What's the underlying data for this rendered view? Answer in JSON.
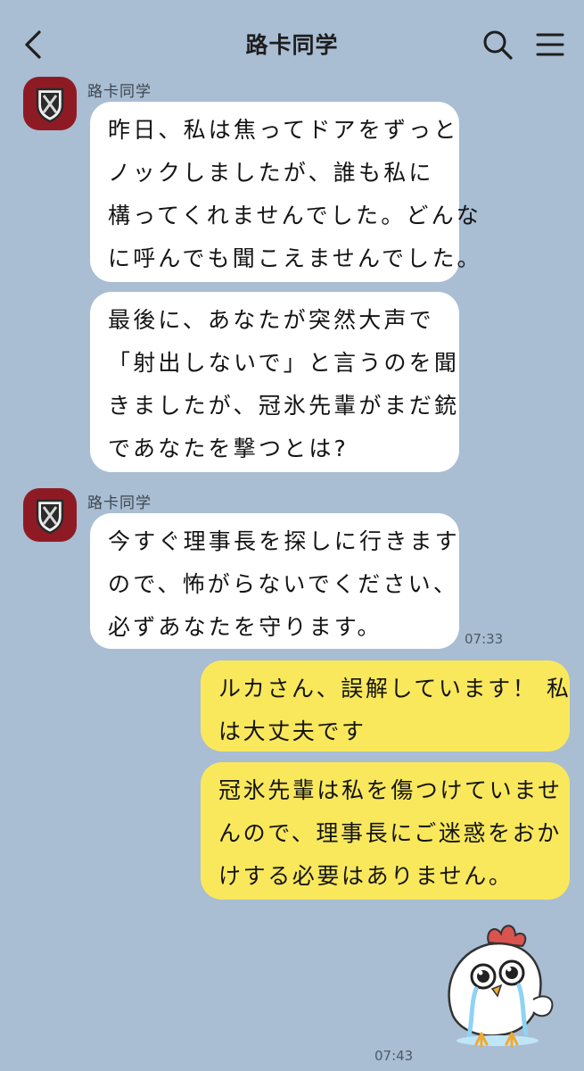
{
  "header": {
    "title": "路卡同学",
    "back_icon": "chevron-left-icon",
    "search_icon": "search-icon",
    "menu_icon": "hamburger-menu-icon"
  },
  "messages": [
    {
      "sender": "路卡同学",
      "lines": [
        "昨日、私は焦ってドアをずっと",
        "ノックしましたが、誰も私に",
        "構ってくれませんでした。どんな",
        "に呼んでも聞こえませんでした。"
      ]
    },
    {
      "lines": [
        "最後に、あなたが突然大声で",
        "「射出しないで」と言うのを聞",
        "きましたが、冠氷先輩がまだ銃",
        "であなたを撃つとは?"
      ]
    },
    {
      "sender": "路卡同学",
      "lines": [
        "今すぐ理事長を探しに行きます",
        "ので、怖がらないでください、",
        "必ずあなたを守ります。"
      ],
      "time": "07:33"
    },
    {
      "mine": true,
      "lines": [
        "ルカさん、誤解しています！ 私",
        "は大丈夫です"
      ]
    },
    {
      "mine": true,
      "lines": [
        "冠氷先輩は私を傷つけていませ",
        "んので、理事長にご迷惑をおか",
        "けする必要はありません。"
      ]
    },
    {
      "mine": true,
      "sticker": "crying-chicken-sticker",
      "time": "07:43"
    }
  ],
  "colors": {
    "background": "#a9bdd3",
    "incoming_bubble": "#ffffff",
    "outgoing_bubble": "#f9e85c",
    "avatar": "#8e1b24"
  }
}
